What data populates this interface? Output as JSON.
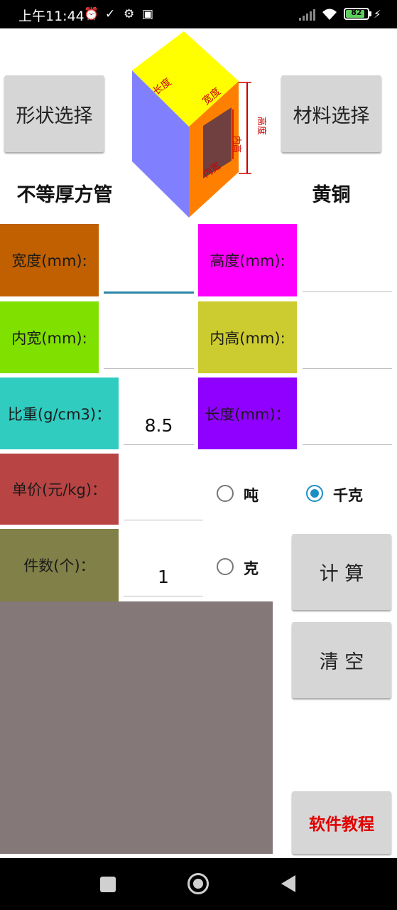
{
  "status_bar": {
    "time": "上午11:44",
    "icons": [
      "alarm-off-icon",
      "check-icon",
      "gear-icon",
      "app-icon",
      "signal-icon",
      "wifi-icon",
      "battery-icon",
      "charging-icon"
    ],
    "battery_level": "82"
  },
  "top": {
    "shape_button": "形状选择",
    "material_button": "材料选择",
    "shape_value": "不等厚方管",
    "material_value": "黄铜",
    "diagram_labels": {
      "length": "长度",
      "width": "宽度",
      "height": "高度",
      "inner_width": "内宽",
      "inner_height": "内高"
    }
  },
  "fields": {
    "width_label": "宽度(mm):",
    "width_value": "",
    "height_label": "高度(mm):",
    "height_value": "",
    "inner_width_label": "内宽(mm):",
    "inner_width_value": "",
    "inner_height_label": "内高(mm):",
    "inner_height_value": "",
    "density_label": "比重(g/cm3)：",
    "density_value": "8.5",
    "length_label": "长度(mm)：",
    "length_value": "",
    "price_label": "单价(元/kg)：",
    "price_value": "",
    "count_label": "件数(个)：",
    "count_value": "1"
  },
  "units": {
    "ton": "吨",
    "kg": "千克",
    "gram": "克",
    "selected": "千克"
  },
  "actions": {
    "calculate": "计 算",
    "clear": "清 空",
    "tutorial": "软件教程"
  },
  "colors": {
    "width_label_bg": "#c06000",
    "height_label_bg": "#ff00ff",
    "inner_width_label_bg": "#80e000",
    "inner_height_label_bg": "#cccc30",
    "density_label_bg": "#30ccc0",
    "length_label_bg": "#9000ff",
    "price_label_bg": "#b84444",
    "count_label_bg": "#808048",
    "result_area_bg": "#857878",
    "tutorial_text": "#e00000",
    "radio_accent": "#1b8fc4"
  }
}
